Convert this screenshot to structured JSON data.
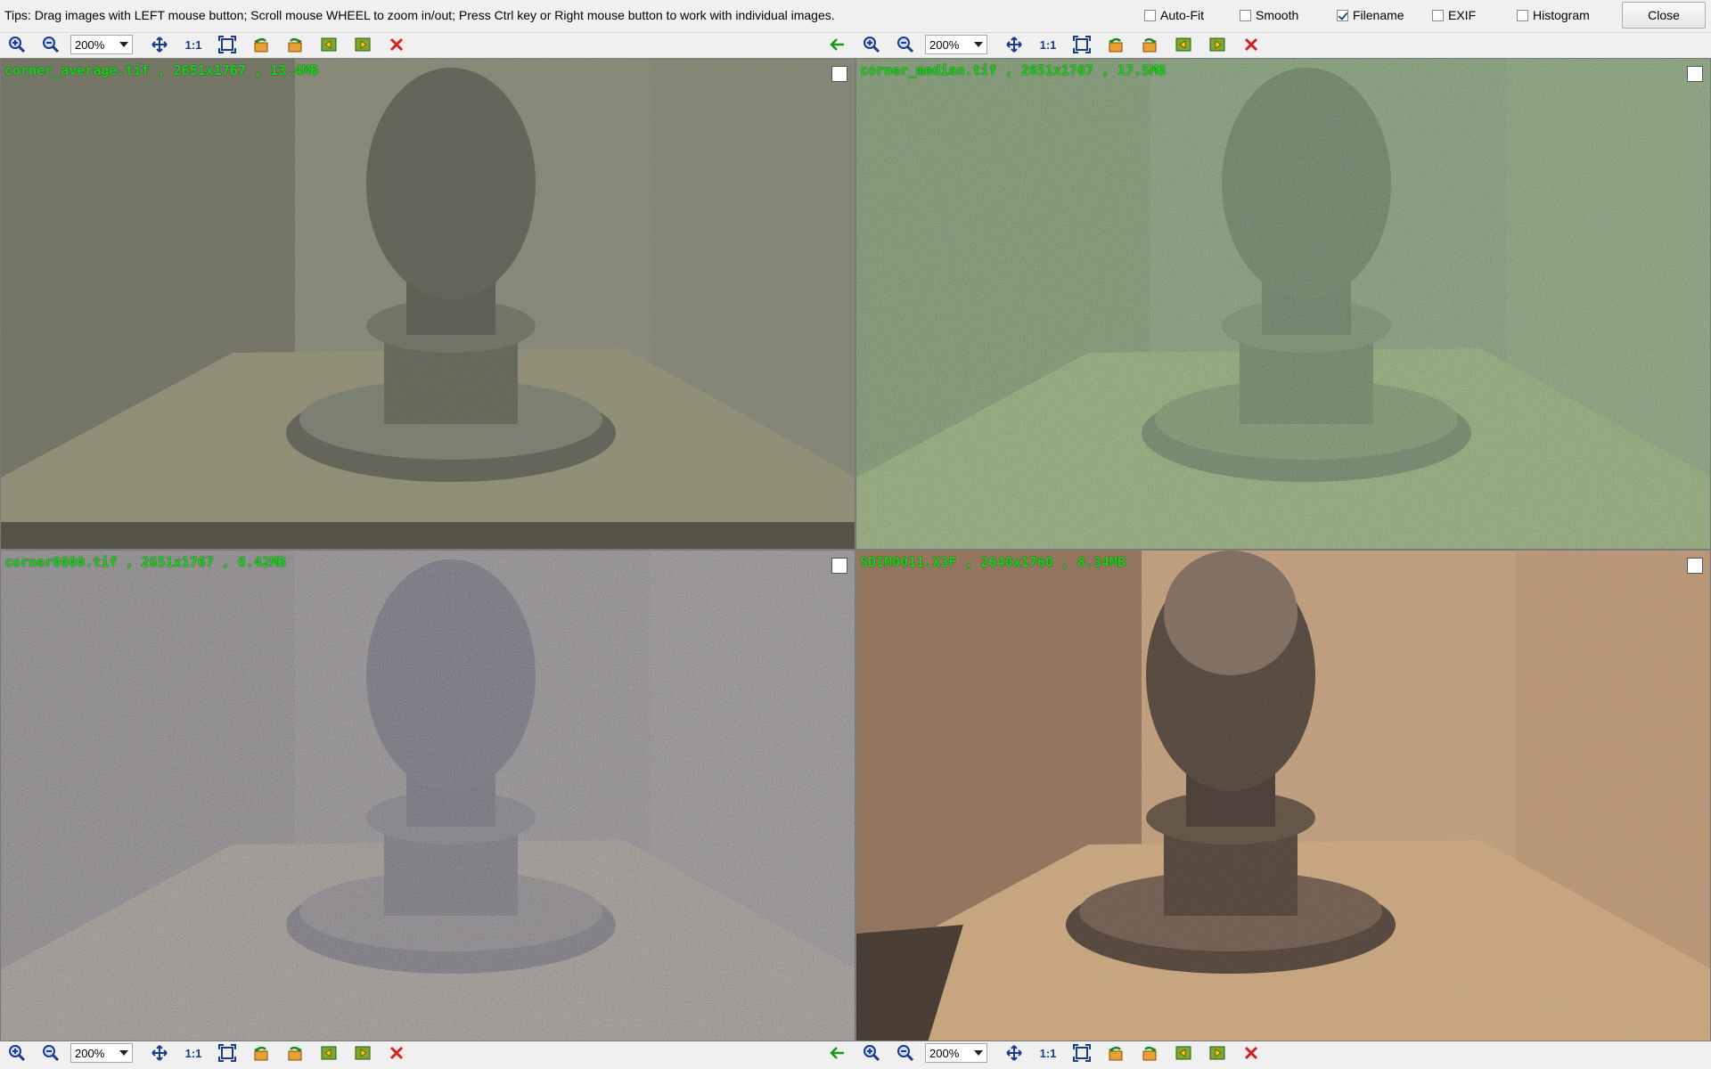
{
  "tips": "Tips: Drag images with LEFT mouse button; Scroll mouse WHEEL to zoom in/out; Press Ctrl key or Right mouse button to work with individual images.",
  "options": [
    {
      "label": "Auto-Fit",
      "checked": false
    },
    {
      "label": "Smooth",
      "checked": false
    },
    {
      "label": "Filename",
      "checked": true
    },
    {
      "label": "EXIF",
      "checked": false
    },
    {
      "label": "Histogram",
      "checked": false
    }
  ],
  "close_label": "Close",
  "toolbar": {
    "zoom": "200%",
    "one_to_one": "1:1",
    "icons": [
      "zoom-in-icon",
      "zoom-out-icon",
      "zoom-select",
      "fit-icon",
      "actual-size-icon",
      "fullscreen-icon",
      "rotate-left-icon",
      "rotate-right-icon",
      "prev-image-icon",
      "next-image-icon",
      "remove-icon"
    ]
  },
  "panes": [
    {
      "filename": "corner_average.tif , 2651x1767 , 13.4MB",
      "tone": "gray"
    },
    {
      "filename": "corner_median.tif , 2651x1767 , 17.5MB",
      "tone": "noisy-green"
    },
    {
      "filename": "corner0000.tif , 2651x1767 , 6.42MB",
      "tone": "noisy-purple"
    },
    {
      "filename": "SDIM0011.X3F , 2640x1760 , 8.34MB",
      "tone": "warm"
    }
  ],
  "colors": {
    "filename_text": "#18d418",
    "remove_icon": "#d62020",
    "back_arrow": "#1a9a1a"
  }
}
